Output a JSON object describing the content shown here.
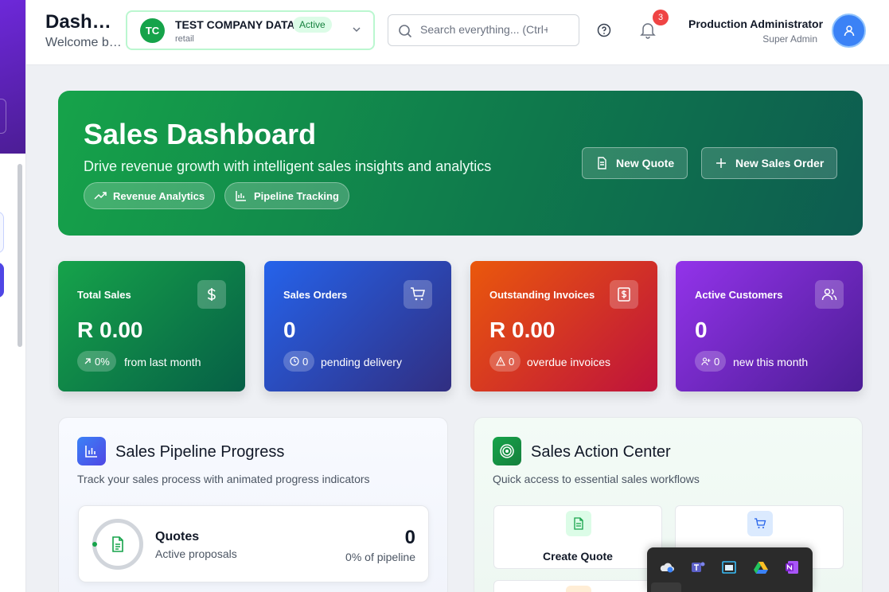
{
  "header": {
    "title": "Dashboard",
    "subtitle": "Welcome back",
    "company": {
      "initials": "TC",
      "name": "TEST COMPANY DATA",
      "status": "Active",
      "type": "retail"
    },
    "search": {
      "placeholder": "Search everything... (Ctrl+K)"
    },
    "notifications_count": "3",
    "user": {
      "name": "Production Administrator",
      "role": "Super Admin"
    }
  },
  "hero": {
    "title": "Sales Dashboard",
    "description": "Drive revenue growth with intelligent sales insights and analytics",
    "pills": [
      "Revenue Analytics",
      "Pipeline Tracking"
    ],
    "buttons": {
      "new_quote": "New Quote",
      "new_sales_order": "New Sales Order"
    }
  },
  "stats": [
    {
      "title": "Total Sales",
      "value": "R 0.00",
      "badge": "0%",
      "note": "from last month",
      "icon": "dollar-icon",
      "color_from": "#16a34a",
      "color_to": "#065f46"
    },
    {
      "title": "Sales Orders",
      "value": "0",
      "badge": "0",
      "note": "pending delivery",
      "icon": "cart-icon",
      "color_from": "#2563eb",
      "color_to": "#312e81"
    },
    {
      "title": "Outstanding Invoices",
      "value": "R 0.00",
      "badge": "0",
      "note": "overdue invoices",
      "icon": "invoice-icon",
      "color_from": "#ea580c",
      "color_to": "#be123c"
    },
    {
      "title": "Active Customers",
      "value": "0",
      "badge": "0",
      "note": "new this month",
      "icon": "users-icon",
      "color_from": "#9333ea",
      "color_to": "#4c1d95"
    }
  ],
  "pipeline": {
    "title": "Sales Pipeline Progress",
    "subtitle": "Track your sales process with animated progress indicators",
    "items": [
      {
        "name": "Quotes",
        "desc": "Active proposals",
        "value": "0",
        "percent_label": "0% of pipeline",
        "progress": 0
      }
    ]
  },
  "actions": {
    "title": "Sales Action Center",
    "subtitle": "Quick access to essential sales workflows",
    "items": [
      {
        "label": "Create Quote",
        "icon": "document-icon"
      },
      {
        "label": "",
        "icon": "cart-icon"
      }
    ]
  },
  "tray": {
    "icons": [
      "onedrive-icon",
      "teams-icon",
      "app-window-icon",
      "drive-icon",
      "onenote-icon"
    ]
  },
  "colors": {
    "primary_green": "#16a34a",
    "accent_blue": "#3b82f6",
    "notification_red": "#ef4444"
  }
}
